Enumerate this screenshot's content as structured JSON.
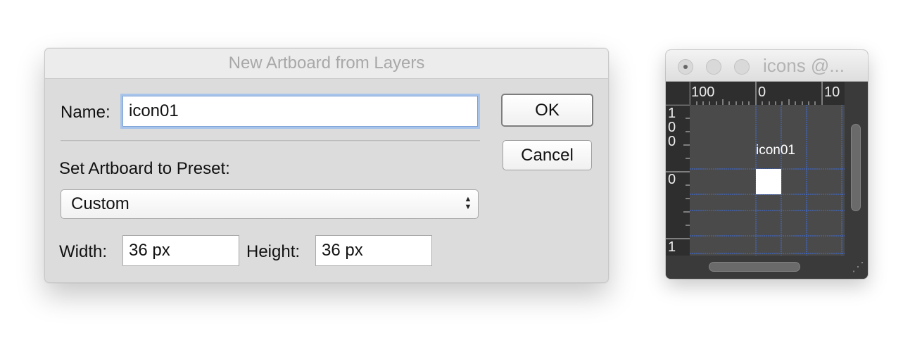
{
  "dialog": {
    "title": "New Artboard from Layers",
    "name_label": "Name:",
    "name_value": "icon01",
    "preset_label": "Set Artboard to Preset:",
    "preset_value": "Custom",
    "width_label": "Width:",
    "width_value": "36 px",
    "height_label": "Height:",
    "height_value": "36 px",
    "ok_label": "OK",
    "cancel_label": "Cancel"
  },
  "canvas_window": {
    "title": "icons @...",
    "ruler_top": [
      "100",
      "0",
      "10"
    ],
    "ruler_left": [
      "1 0 0",
      "0",
      "1"
    ],
    "artboard_label": "icon01",
    "controls": [
      "close-icon",
      "minimize-icon",
      "zoom-icon"
    ],
    "grid_color": "#3f6fe0",
    "canvas_color": "#4a4a4a"
  }
}
